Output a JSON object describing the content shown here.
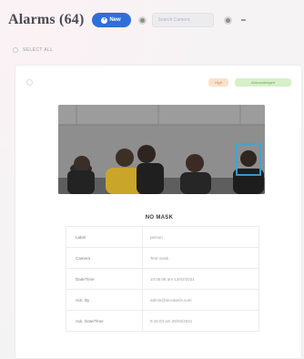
{
  "header": {
    "title": "Alarms (64)",
    "new_label": "New",
    "search_placeholder": "Search Camera"
  },
  "select_all_label": "SELECT ALL",
  "alarm": {
    "severity": "High",
    "status": "Acknowledged",
    "label_title": "NO MASK",
    "details": [
      {
        "key": "Label",
        "value": "person"
      },
      {
        "key": "Camera",
        "value": "Test mask"
      },
      {
        "key": "Date/Time",
        "value": "10:05:08 am 12/02/2021"
      },
      {
        "key": "Ack. By",
        "value": "admin@slocatech.com"
      },
      {
        "key": "Ack. Date/Time",
        "value": "9:15:03 am 25/03/2021"
      }
    ]
  },
  "colors": {
    "accent": "#2f6fd8",
    "detection_box": "#35a9d8",
    "severity_bg": "#fbe1c9",
    "ack_bg": "#d6f0c7"
  },
  "icons": [
    "gear-icon",
    "settings-icon",
    "more-icon",
    "plus-icon"
  ]
}
